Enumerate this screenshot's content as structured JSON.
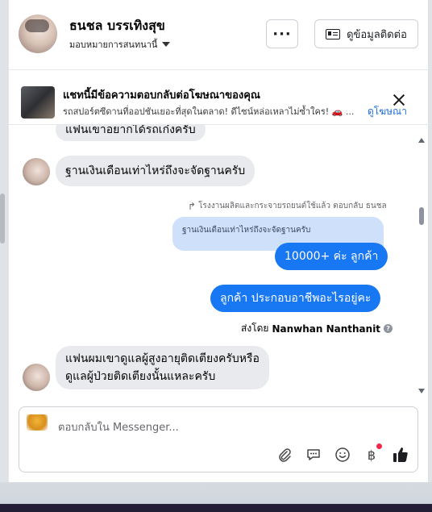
{
  "header": {
    "contact_name": "ธนชล บรรเทิงสุข",
    "assign_label": "มอบหมายการสนทนานี้",
    "more_label": "···",
    "contact_info_label": "ดูข้อมูลติดต่อ"
  },
  "ad_banner": {
    "title": "แชทนี้มีข้อความตอบกลับต่อโฆษณาของคุณ",
    "subtitle": "รถสปอร์ตซีดานที่ออปชันเยอะที่สุดในตลาด! ดีไซน์หล่อเหลาไม่ซ้ำใคร! 🚗 ...",
    "link_label": "ดูโฆษณา"
  },
  "messages": {
    "msg_partial": "แฟนเขาอยากได้รถเก๋งครับ",
    "msg_income_question": "ฐานเงินเดือนเท่าไหร่ถึงจะจัดฐานครับ",
    "reply_meta": "โรงงานผลิตและกระจายรถยนต์ใช้แล้ว ตอบกลับ ธนชล",
    "quoted_text": "ฐานเงินเดือนเท่าไหร่ถึงจะจัดฐานครับ",
    "reply_income": "10000+ ค่ะ  ลูกค้า",
    "reply_occupation": "ลูกค้า ประกอบอาชีพอะไรอยู่คะ",
    "sent_by_prefix": "ส่งโดย",
    "sent_by_name": "Nanwhan Nanthanit",
    "msg_caregiver_line1": "แฟนผมเขาดูแลผู้สูงอายุติดเตียงครับหรือ",
    "msg_caregiver_line2": "ดูแลผู้ป่วยติดเตียงนั้นแหละครับ"
  },
  "composer": {
    "placeholder": "ตอบกลับใน Messenger...",
    "tools": [
      "paperclip-icon",
      "saved-reply-icon",
      "emoji-icon",
      "baht-payment-icon",
      "like-icon"
    ],
    "payment_symbol": "฿"
  },
  "colors": {
    "accent": "#1877f2",
    "incoming_bubble": "#e9eaed",
    "link": "#216fdb",
    "notification": "#f02849"
  }
}
